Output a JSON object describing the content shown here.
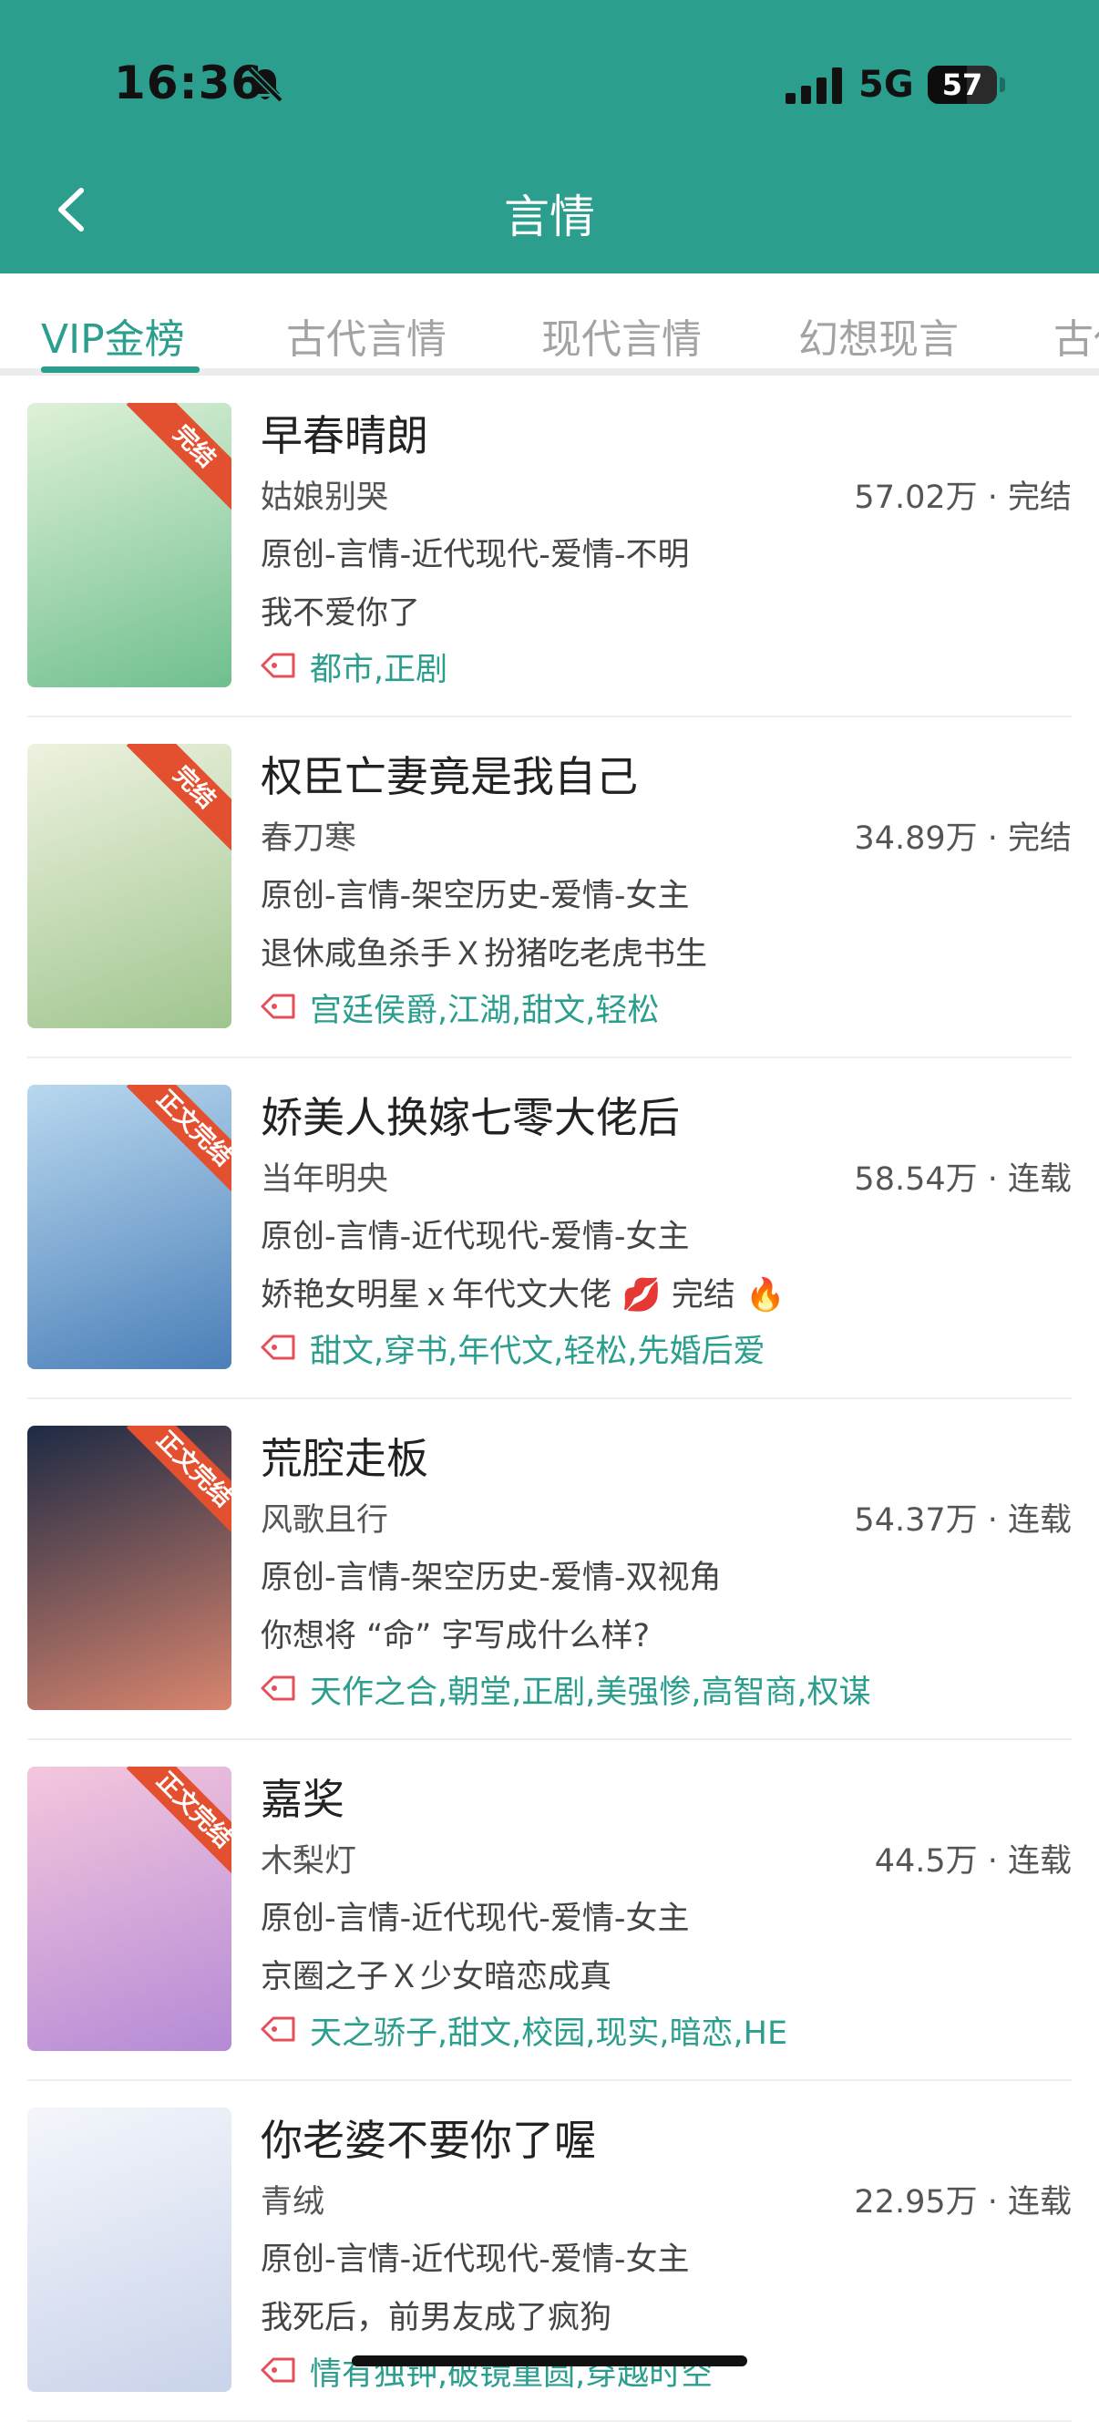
{
  "status_bar": {
    "time": "16:36",
    "network": "5G",
    "battery": "57",
    "battery_level": 0.57
  },
  "header": {
    "title": "言情"
  },
  "tabs": [
    {
      "label": "VIP金榜",
      "active": true
    },
    {
      "label": "古代言情",
      "active": false
    },
    {
      "label": "现代言情",
      "active": false
    },
    {
      "label": "幻想现言",
      "active": false
    },
    {
      "label": "古代",
      "active": false
    }
  ],
  "books": [
    {
      "title": "早春晴朗",
      "author": "姑娘别哭",
      "stats": "57.02万 · 完结",
      "category": "原创-言情-近代现代-爱情-不明",
      "desc": "我不爱你了",
      "tags": "都市,正剧",
      "ribbon": "完结",
      "cover_colors": [
        "#dff1d9",
        "#6fbf8e"
      ]
    },
    {
      "title": "权臣亡妻竟是我自己",
      "author": "春刀寒",
      "stats": "34.89万 · 完结",
      "category": "原创-言情-架空历史-爱情-女主",
      "desc": "退休咸鱼杀手Ｘ扮猪吃老虎书生",
      "tags": "宫廷侯爵,江湖,甜文,轻松",
      "ribbon": "完结",
      "cover_colors": [
        "#eef2df",
        "#9fc58f"
      ]
    },
    {
      "title": "娇美人换嫁七零大佬后",
      "author": "当年明央",
      "stats": "58.54万 · 连载",
      "category": "原创-言情-近代现代-爱情-女主",
      "desc": "娇艳女明星ｘ年代文大佬 💋 完结 🔥",
      "tags": "甜文,穿书,年代文,轻松,先婚后爱",
      "ribbon": "正文完结",
      "cover_colors": [
        "#b9d8ef",
        "#4a7fb8"
      ]
    },
    {
      "title": "荒腔走板",
      "author": "风歌且行",
      "stats": "54.37万 · 连载",
      "category": "原创-言情-架空历史-爱情-双视角",
      "desc": "你想将 “命” 字写成什么样?",
      "tags": "天作之合,朝堂,正剧,美强惨,高智商,权谋",
      "ribbon": "正文完结",
      "cover_colors": [
        "#1d2a44",
        "#d9856e"
      ]
    },
    {
      "title": "嘉奖",
      "author": "木梨灯",
      "stats": "44.5万 · 连载",
      "category": "原创-言情-近代现代-爱情-女主",
      "desc": "京圈之子Ｘ少女暗恋成真",
      "tags": "天之骄子,甜文,校园,现实,暗恋,HE",
      "ribbon": "正文完结",
      "cover_colors": [
        "#f5c7dd",
        "#b48ad6"
      ]
    },
    {
      "title": "你老婆不要你了喔",
      "author": "青绒",
      "stats": "22.95万 · 连载",
      "category": "原创-言情-近代现代-爱情-女主",
      "desc": "我死后，前男友成了疯狗",
      "tags": "情有独钟,破镜重圆,穿越时空",
      "ribbon": "",
      "cover_colors": [
        "#f4f6fb",
        "#c9d3ea"
      ]
    }
  ]
}
